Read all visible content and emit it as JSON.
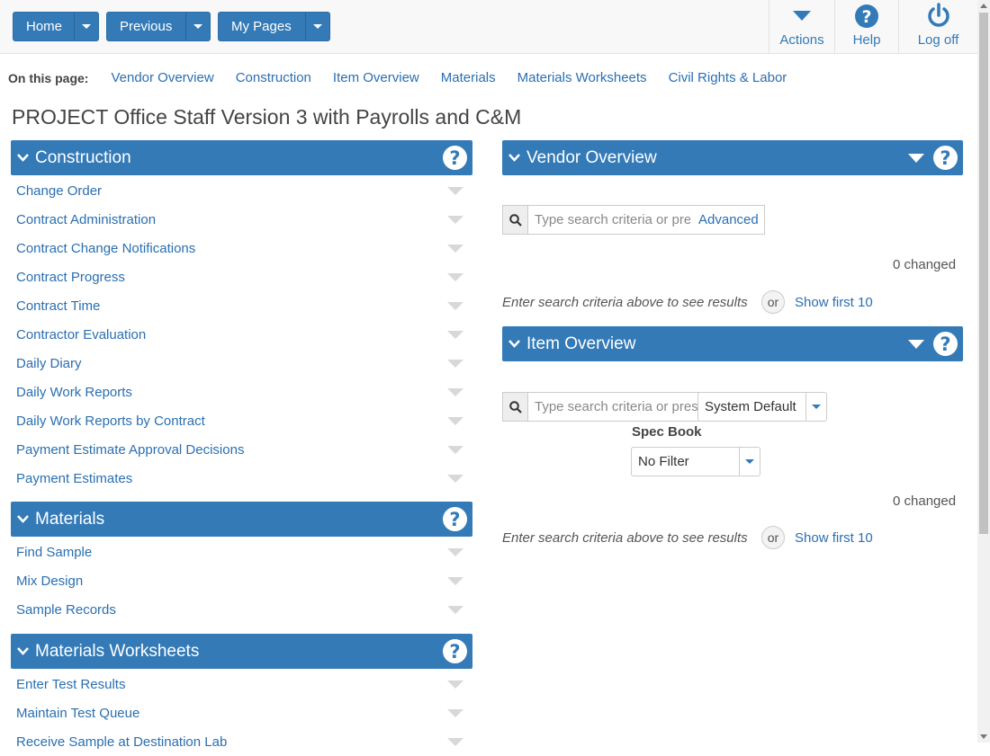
{
  "topbar": {
    "home_label": "Home",
    "previous_label": "Previous",
    "mypages_label": "My Pages",
    "actions_label": "Actions",
    "help_label": "Help",
    "logoff_label": "Log off"
  },
  "onpage": {
    "label": "On this page:",
    "links": [
      "Vendor Overview",
      "Construction",
      "Item Overview",
      "Materials",
      "Materials Worksheets",
      "Civil Rights & Labor"
    ]
  },
  "page_title": "PROJECT Office Staff Version 3 with Payrolls and C&M",
  "construction": {
    "title": "Construction",
    "items": [
      "Change Order",
      "Contract Administration",
      "Contract Change Notifications",
      "Contract Progress",
      "Contract Time",
      "Contractor Evaluation",
      "Daily Diary",
      "Daily Work Reports",
      "Daily Work Reports by Contract",
      "Payment Estimate Approval Decisions",
      "Payment Estimates"
    ]
  },
  "materials": {
    "title": "Materials",
    "items": [
      "Find Sample",
      "Mix Design",
      "Sample Records"
    ]
  },
  "materials_worksheets": {
    "title": "Materials Worksheets",
    "items": [
      "Enter Test Results",
      "Maintain Test Queue",
      "Receive Sample at Destination Lab"
    ]
  },
  "vendor_overview": {
    "title": "Vendor Overview",
    "search_placeholder": "Type search criteria or press Enter",
    "advanced_label": "Advanced",
    "changed": "0 changed",
    "hint": "Enter search criteria above to see results",
    "or": "or",
    "show_first": "Show first 10"
  },
  "item_overview": {
    "title": "Item Overview",
    "search_placeholder": "Type search criteria or press Enter",
    "view_select": "System Default",
    "spec_book_label": "Spec Book",
    "spec_book_value": "No Filter",
    "changed": "0 changed",
    "hint": "Enter search criteria above to see results",
    "or": "or",
    "show_first": "Show first 10"
  },
  "help_glyph": "?",
  "colors": {
    "accent": "#337ab7",
    "link": "#2a6fb1"
  }
}
